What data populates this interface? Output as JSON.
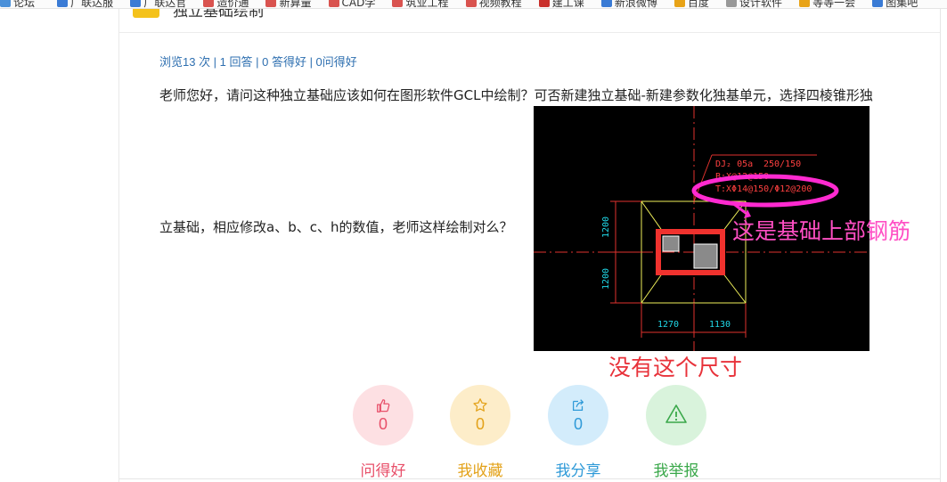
{
  "bookmarks": [
    {
      "label": "论坛_",
      "color": "#4a90d9"
    },
    {
      "label": "广联达服",
      "color": "#3a7bd5"
    },
    {
      "label": "广联达官",
      "color": "#3a7bd5"
    },
    {
      "label": "造价通",
      "color": "#d9534f"
    },
    {
      "label": "新算量",
      "color": "#d9534f"
    },
    {
      "label": "CAD学",
      "color": "#d9534f"
    },
    {
      "label": "筑业工程",
      "color": "#d9534f"
    },
    {
      "label": "视频教程",
      "color": "#d9534f"
    },
    {
      "label": "建工课",
      "color": "#c9302c"
    },
    {
      "label": "新浪微博",
      "color": "#3a7bd5"
    },
    {
      "label": "百度",
      "color": "#e8a317"
    },
    {
      "label": "设计软件",
      "color": "#999999"
    },
    {
      "label": "等等一会",
      "color": "#e8a317"
    },
    {
      "label": "图集吧",
      "color": "#3a7bd5"
    }
  ],
  "page": {
    "title": "独立基础绘制",
    "stats": "浏览13 次 | 1 回答 | 0 答得好 | 0问得好",
    "question_line1": "老师您好，请问这种独立基础应该如何在图形软件GCL中绘制？可否新建独立基础-新建参数化独基单元，选择四棱锥形独",
    "question_line2": "立基础，相应修改a、b、c、h的数值，老师这样绘制对么？"
  },
  "drawing": {
    "dj_label": "DJ₂ 05a",
    "height_label": "250/150",
    "rebar_bottom": "B:X@12@150",
    "rebar_top": "T:XΦ14@150/Φ12@200",
    "dim_left_top": "1200",
    "dim_left_bottom": "1200",
    "dim_bottom_left": "1270",
    "dim_bottom_right": "1130",
    "annotation_top": "这是基础上部钢筋",
    "annotation_bottom": "没有这个尺寸"
  },
  "actions": [
    {
      "label": "问得好",
      "count": "0",
      "icon": "thumbs-up-icon",
      "bg": "#fde0e3",
      "color": "#e8506a"
    },
    {
      "label": "我收藏",
      "count": "0",
      "icon": "star-icon",
      "bg": "#fdedc9",
      "color": "#e3a21a"
    },
    {
      "label": "我分享",
      "count": "0",
      "icon": "share-icon",
      "bg": "#d3ecfb",
      "color": "#2f9ad8"
    },
    {
      "label": "我举报",
      "count": "",
      "icon": "warning-icon",
      "bg": "#d9f3dc",
      "color": "#3aa84a"
    }
  ]
}
